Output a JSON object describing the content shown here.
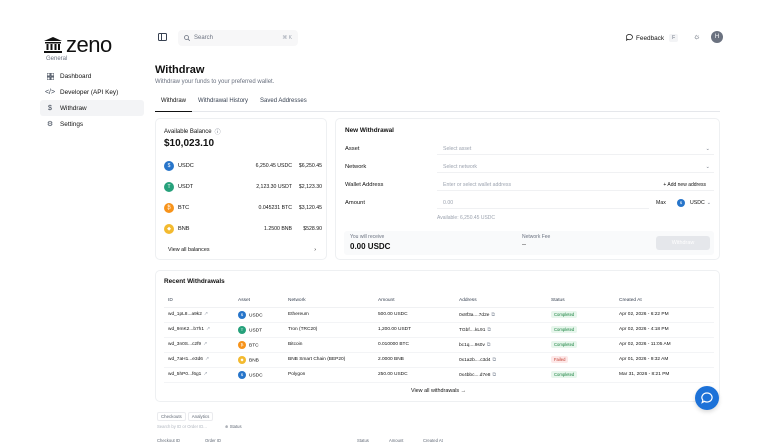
{
  "app": {
    "brand": "zeno"
  },
  "sidebar": {
    "section": "General",
    "items": [
      {
        "label": "Dashboard",
        "icon": "grid-icon"
      },
      {
        "label": "Developer (API Key)",
        "icon": "code-icon"
      },
      {
        "label": "Withdraw",
        "icon": "dollar-icon"
      },
      {
        "label": "Settings",
        "icon": "gear-icon"
      }
    ]
  },
  "topbar": {
    "search_placeholder": "Search",
    "search_shortcut": "⌘ K",
    "feedback_label": "Feedback",
    "feedback_key": "F",
    "avatar_initial": "H"
  },
  "page": {
    "title": "Withdraw",
    "subtitle": "Withdraw your funds to your preferred wallet.",
    "tabs": [
      "Withdraw",
      "Withdrawal History",
      "Saved Addresses"
    ]
  },
  "balance": {
    "label": "Available Balance",
    "total": "$10,023.10",
    "assets": [
      {
        "symbol": "USDC",
        "amount": "6,250.45 USDC",
        "usd": "$6,250.45",
        "color": "#2775ca"
      },
      {
        "symbol": "USDT",
        "amount": "2,123.30 USDT",
        "usd": "$2,123.30",
        "color": "#26a17b"
      },
      {
        "symbol": "BTC",
        "amount": "0.045231 BTC",
        "usd": "$3,120.45",
        "color": "#f7931a"
      },
      {
        "symbol": "BNB",
        "amount": "1.2500 BNB",
        "usd": "$528.90",
        "color": "#f3ba2f"
      }
    ],
    "view_all": "View all balances"
  },
  "new_withdrawal": {
    "title": "New Withdrawal",
    "asset_label": "Asset",
    "asset_placeholder": "Select asset",
    "network_label": "Network",
    "network_placeholder": "Select network",
    "address_label": "Wallet Address",
    "address_placeholder": "Enter or select wallet address",
    "add_address": "+ Add new address",
    "amount_label": "Amount",
    "amount_placeholder": "0.00",
    "max_label": "Max",
    "currency": "USDC",
    "available": "Available: 6,250.45 USDC",
    "receive_label": "You will receive",
    "receive_value": "0.00 USDC",
    "fee_label": "Network Fee",
    "fee_value": "--",
    "button": "Withdraw"
  },
  "recent": {
    "title": "Recent Withdrawals",
    "columns": [
      "ID",
      "Asset",
      "Network",
      "Amount",
      "Address",
      "Status",
      "Created At"
    ],
    "rows": [
      {
        "id": "wd_1pL8...a9k2",
        "asset": "USDC",
        "network": "Ethereum",
        "amount": "500.00 USDC",
        "address": "0x8f3a....7d2e",
        "status": "Completed",
        "created": "Apr 02, 2026 - 6:22 PM",
        "color": "#2775ca"
      },
      {
        "id": "wd_9mK2...b7h1",
        "asset": "USDT",
        "network": "Tron (TRC20)",
        "amount": "1,200.00 USDT",
        "address": "TGbf....kL91",
        "status": "Completed",
        "created": "Apr 02, 2026 - 4:18 PM",
        "color": "#26a17b"
      },
      {
        "id": "wd_3n0S...c2f9",
        "asset": "BTC",
        "network": "Bitcoin",
        "amount": "0.010000 BTC",
        "address": "bc1q....9s0v",
        "status": "Completed",
        "created": "Apr 02, 2026 - 11:05 AM",
        "color": "#f7931a"
      },
      {
        "id": "wd_7aH1...e3d6",
        "asset": "BNB",
        "network": "BNB Smart Chain (BEP20)",
        "amount": "2.0000 BNB",
        "address": "0x1a2b....c3d4",
        "status": "Failed",
        "created": "Apr 01, 2026 - 9:32 AM",
        "color": "#f3ba2f"
      },
      {
        "id": "wd_5hP0...f6g1",
        "asset": "USDC",
        "network": "Polygon",
        "amount": "250.00 USDC",
        "address": "0x4bbc....d7e8",
        "status": "Completed",
        "created": "Mar 31, 2026 - 8:21 PM",
        "color": "#2775ca"
      }
    ],
    "view_all": "View all withdrawals →"
  },
  "bottom": {
    "tabs": [
      "Checkouts",
      "Analytics"
    ],
    "search": "Search by ID or Order ID...",
    "status": "Status",
    "columns": [
      "Checkout ID",
      "Order ID",
      "Status",
      "Amount",
      "Created At"
    ]
  },
  "colors": {
    "accent": "#1d72d8",
    "success": "#16803c",
    "danger": "#c0392b"
  }
}
